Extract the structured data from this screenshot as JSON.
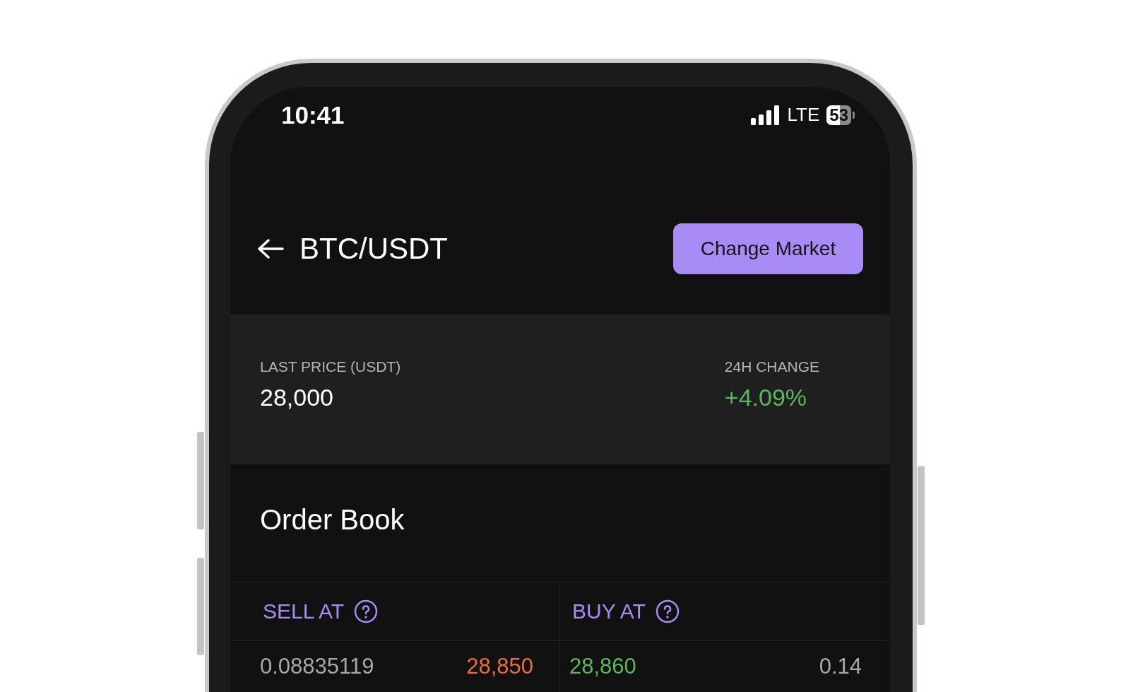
{
  "status_bar": {
    "time": "10:41",
    "network": "LTE",
    "battery": "53"
  },
  "header": {
    "title": "BTC/USDT",
    "button": "Change Market"
  },
  "stats": [
    {
      "label": "LAST PRICE (USDT)",
      "value": "28,000",
      "color": "#ffffff"
    },
    {
      "label": "24H CHANGE",
      "value": "+4.09%",
      "color": "#5cb85c"
    }
  ],
  "order_book": {
    "title": "Order Book",
    "columns": [
      {
        "label": "SELL AT"
      },
      {
        "label": "BUY AT"
      }
    ],
    "rows": [
      {
        "sell_amount": "0.08835119",
        "sell_price": "28,850",
        "buy_price": "28,860",
        "buy_amount": "0.14"
      }
    ]
  }
}
